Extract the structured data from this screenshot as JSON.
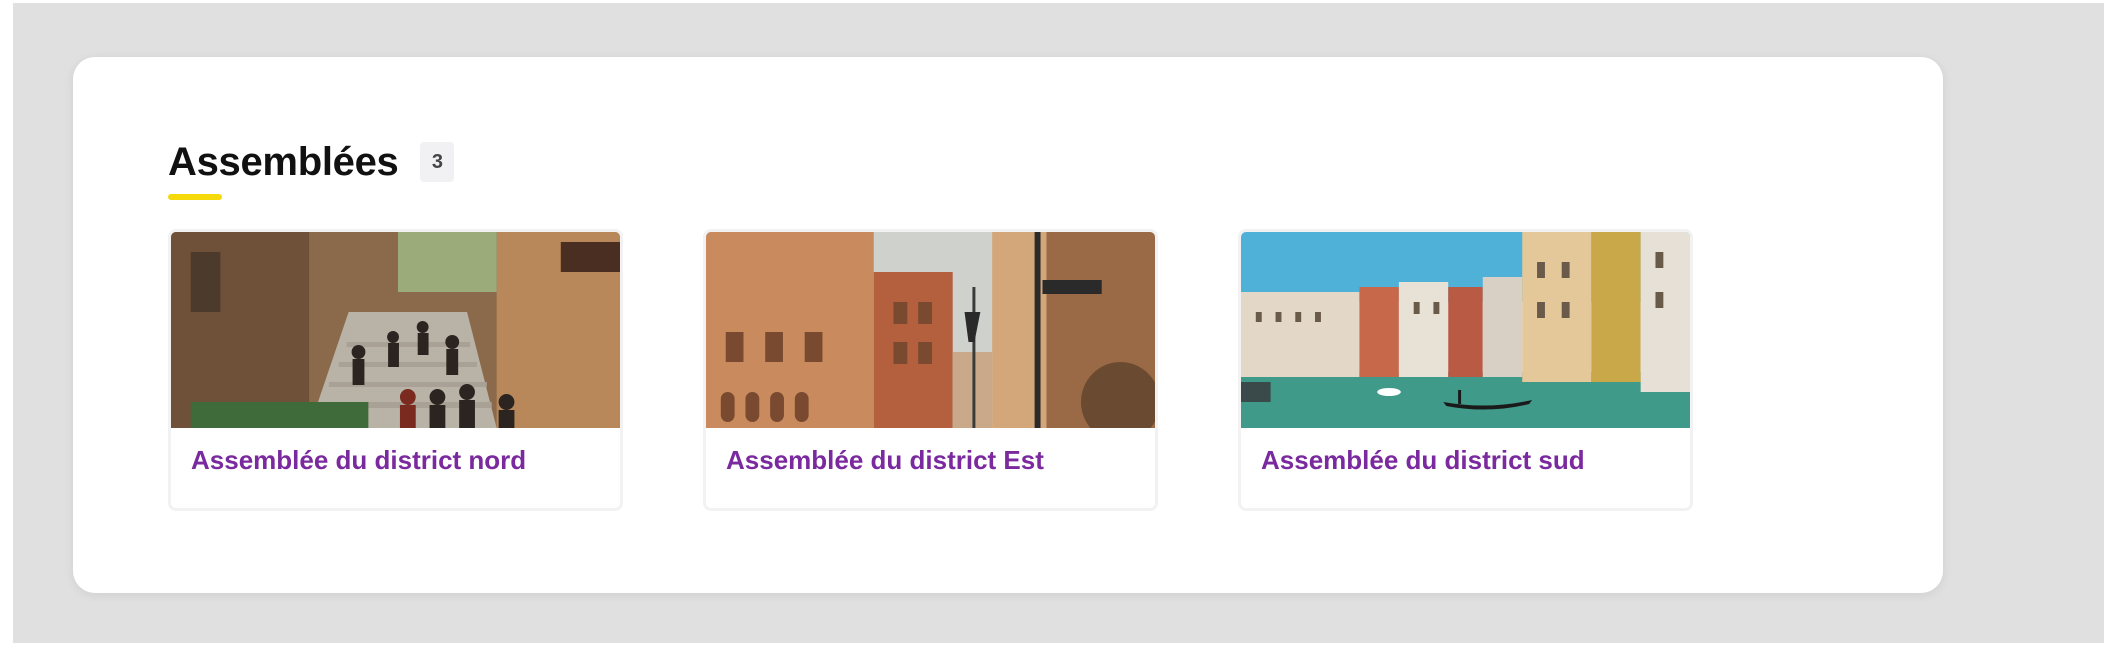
{
  "section": {
    "title": "Assemblées",
    "count": "3"
  },
  "colors": {
    "accent_underline": "#f5d90a",
    "card_title": "#7a2a9e"
  },
  "assemblies": [
    {
      "title": "Assemblée du district nord",
      "image": "crowded-stairway-street-photo"
    },
    {
      "title": "Assemblée du district Est",
      "image": "old-town-street-buildings-photo"
    },
    {
      "title": "Assemblée du district sud",
      "image": "canal-gondola-photo"
    }
  ]
}
